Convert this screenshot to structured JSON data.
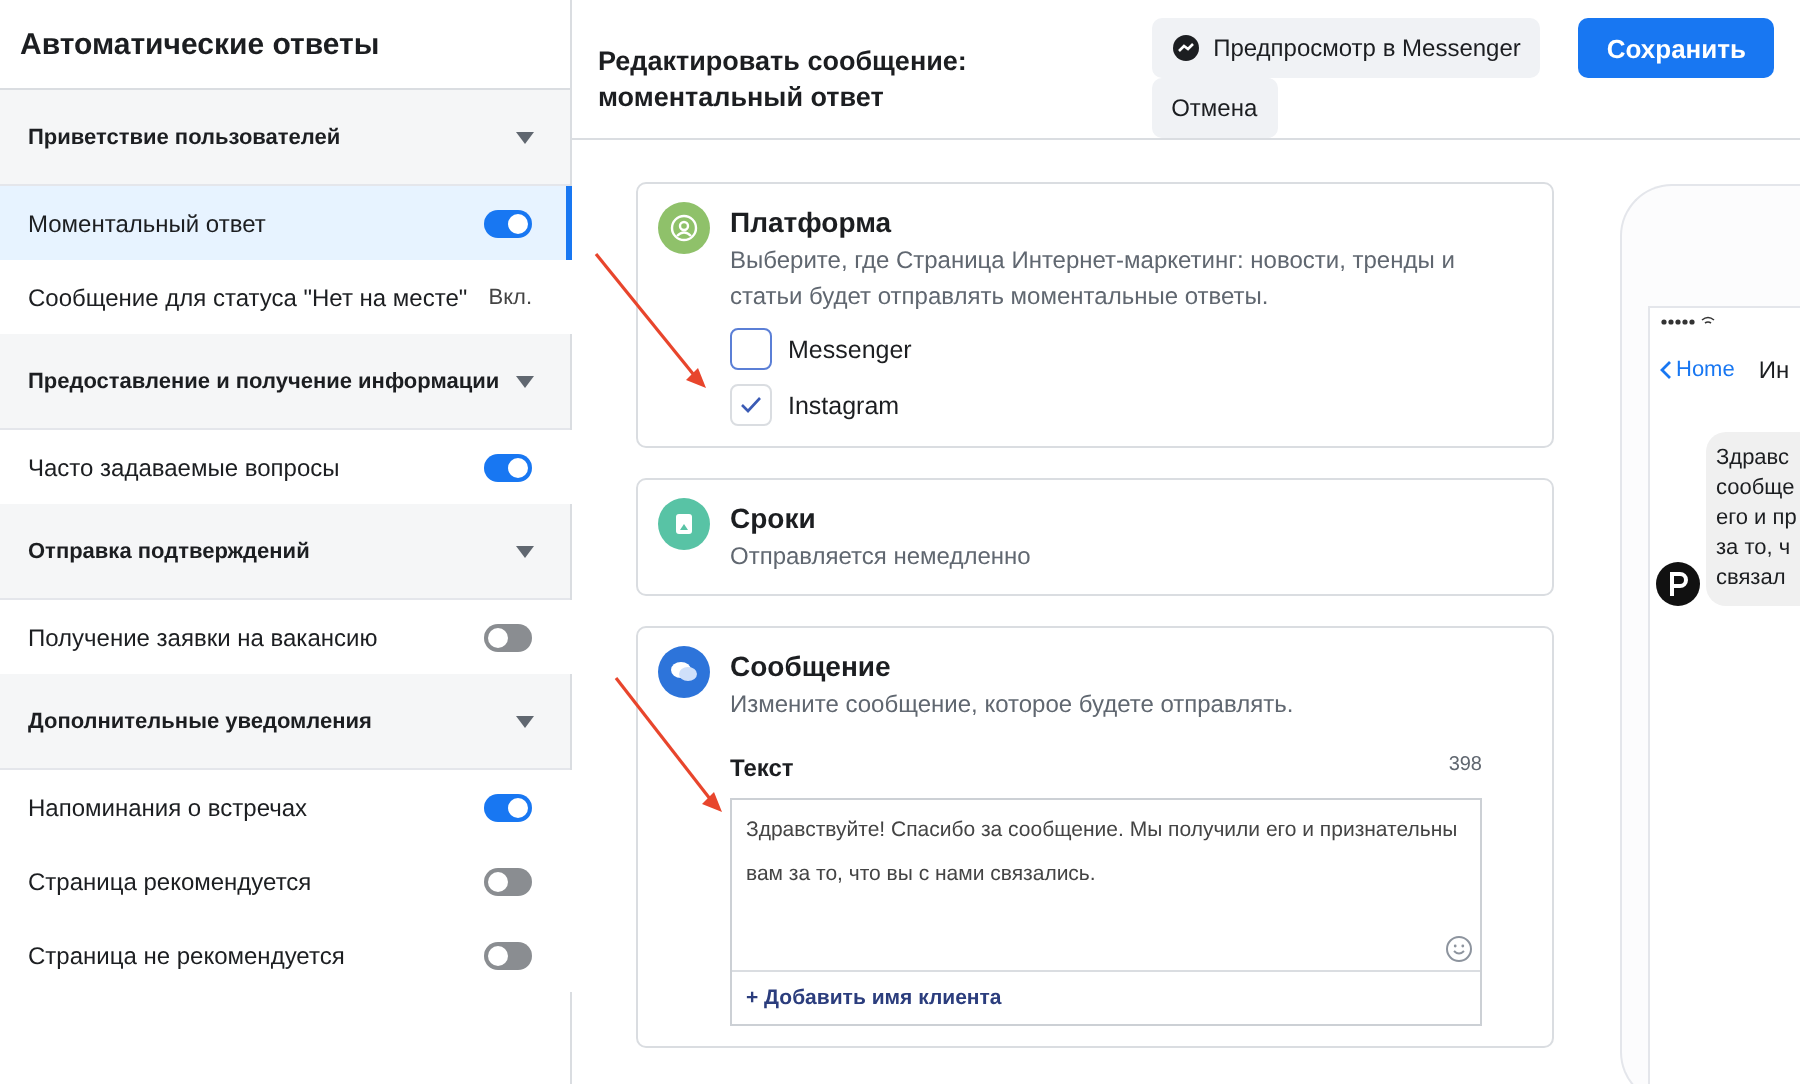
{
  "sidebar": {
    "title": "Автоматические ответы",
    "sections": [
      {
        "title": "Приветствие пользователей",
        "expanded": true,
        "items": [
          {
            "label": "Моментальный ответ",
            "kind": "toggle",
            "on": true,
            "selected": true
          },
          {
            "label": "Сообщение для статуса \"Нет на месте\"",
            "kind": "status",
            "status": "Вкл.",
            "selected": false
          }
        ]
      },
      {
        "title": "Предоставление и получение информации",
        "expanded": true,
        "items": [
          {
            "label": "Часто задаваемые вопросы",
            "kind": "toggle",
            "on": true,
            "selected": false
          }
        ]
      },
      {
        "title": "Отправка подтверждений",
        "expanded": true,
        "items": [
          {
            "label": "Получение заявки на вакансию",
            "kind": "toggle",
            "on": false,
            "selected": false
          }
        ]
      },
      {
        "title": "Дополнительные уведомления",
        "expanded": true,
        "items": [
          {
            "label": "Напоминания о встречах",
            "kind": "toggle",
            "on": true,
            "selected": false
          },
          {
            "label": "Страница рекомендуется",
            "kind": "toggle",
            "on": false,
            "selected": false
          },
          {
            "label": "Страница не рекомендуется",
            "kind": "toggle",
            "on": false,
            "selected": false
          }
        ]
      }
    ]
  },
  "header": {
    "title": "Редактировать сообщение: моментальный ответ",
    "preview_button": "Предпросмотр в Messenger",
    "cancel_button": "Отмена",
    "save_button": "Сохранить"
  },
  "platform_card": {
    "title": "Платформа",
    "description": "Выберите, где Страница Интернет-маркетинг: новости, тренды и статьи будет отправлять моментальные ответы.",
    "options": [
      {
        "label": "Messenger",
        "checked": false
      },
      {
        "label": "Instagram",
        "checked": true
      }
    ]
  },
  "timing_card": {
    "title": "Сроки",
    "description": "Отправляется немедленно"
  },
  "message_card": {
    "title": "Сообщение",
    "description": "Измените сообщение, которое будете отправлять.",
    "field_label": "Текст",
    "counter": "398",
    "value": "Здравствуйте! Спасибо за сообщение. Мы получили его и признательны вам за то, что вы с нами связались.",
    "add_link": "+ Добавить имя клиента"
  },
  "phone_preview": {
    "back": "Home",
    "title": "Ин",
    "bubble_lines": [
      "Здравс",
      "сообще",
      "его и пр",
      "за то, ч",
      "связал"
    ]
  }
}
